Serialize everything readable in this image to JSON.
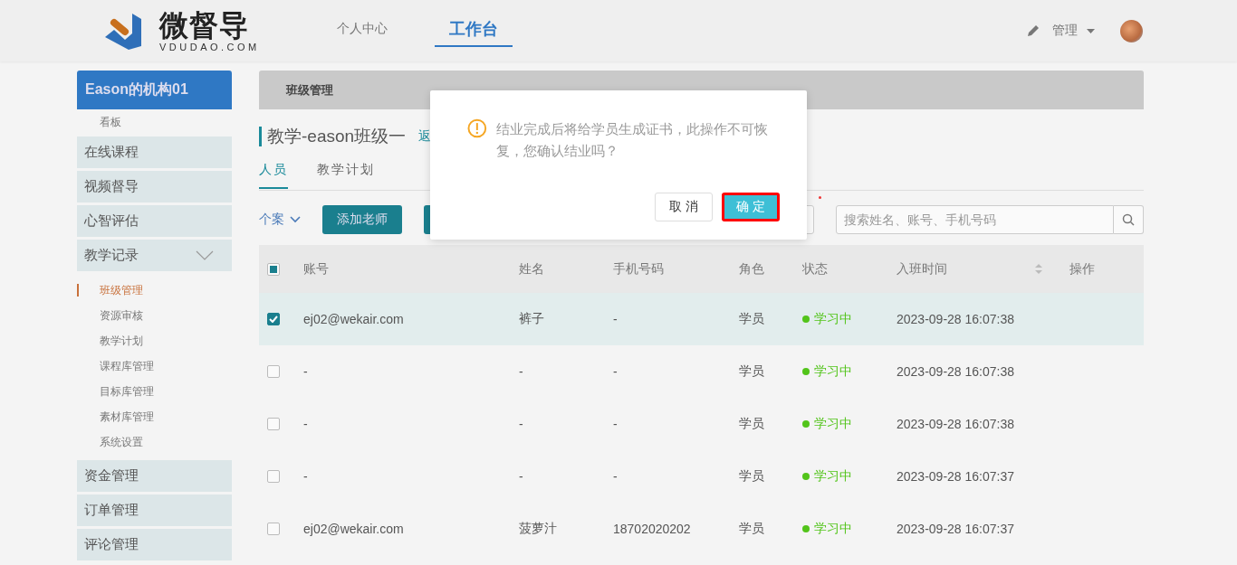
{
  "header": {
    "logo_text": "微督导",
    "logo_domain": "VDUDAO.COM",
    "nav": [
      {
        "label": "个人中心",
        "selected": false
      },
      {
        "label": "工作台",
        "selected": true
      }
    ],
    "user_menu": "管理"
  },
  "sidebar": {
    "org": "Eason的机构01",
    "items": [
      {
        "label": "看板",
        "kind": "sub",
        "selected": false
      },
      {
        "label": "在线课程",
        "kind": "group"
      },
      {
        "label": "视频督导",
        "kind": "group"
      },
      {
        "label": "心智评估",
        "kind": "group"
      },
      {
        "label": "教学记录",
        "kind": "group",
        "expanded": true,
        "children": [
          {
            "label": "班级管理",
            "selected": true
          },
          {
            "label": "资源审核",
            "selected": false
          },
          {
            "label": "教学计划",
            "selected": false
          },
          {
            "label": "课程库管理",
            "selected": false
          },
          {
            "label": "目标库管理",
            "selected": false
          },
          {
            "label": "素材库管理",
            "selected": false
          },
          {
            "label": "系统设置",
            "selected": false
          }
        ]
      },
      {
        "label": "资金管理",
        "kind": "group"
      },
      {
        "label": "订单管理",
        "kind": "group"
      },
      {
        "label": "评论管理",
        "kind": "group"
      }
    ]
  },
  "breadcrumb": "班级管理",
  "class_title": "教学-eason班级一",
  "back_link": "返",
  "tabs": [
    {
      "label": "人员",
      "selected": true
    },
    {
      "label": "教学计划",
      "selected": false
    }
  ],
  "toolbar": {
    "filter": "个案",
    "add_button": "添加老师",
    "search": {
      "placeholder": "搜索姓名、账号、手机号码"
    }
  },
  "table": {
    "header_checkbox": {
      "indeterminate": true
    },
    "columns": [
      "账号",
      "姓名",
      "手机号码",
      "角色",
      "状态",
      "入班时间",
      "操作"
    ],
    "rows": [
      {
        "checked": true,
        "account": "ej02@wekair.com",
        "name": "裤子",
        "phone": "-",
        "role": "学员",
        "status": "学习中",
        "color": "#52c41a",
        "joined": "2023-09-28 16:07:38"
      },
      {
        "checked": false,
        "account": "-",
        "name": "-",
        "phone": "-",
        "role": "学员",
        "status": "学习中",
        "color": "#52c41a",
        "joined": "2023-09-28 16:07:38"
      },
      {
        "checked": false,
        "account": "-",
        "name": "-",
        "phone": "-",
        "role": "学员",
        "status": "学习中",
        "color": "#52c41a",
        "joined": "2023-09-28 16:07:38"
      },
      {
        "checked": false,
        "account": "-",
        "name": "-",
        "phone": "-",
        "role": "学员",
        "status": "学习中",
        "color": "#52c41a",
        "joined": "2023-09-28 16:07:37"
      },
      {
        "checked": false,
        "account": "ej02@wekair.com",
        "name": "菠萝汁",
        "phone": "18702020202",
        "role": "学员",
        "status": "学习中",
        "color": "#52c41a",
        "joined": "2023-09-28 16:07:37"
      }
    ]
  },
  "dialog": {
    "message": "结业完成后将给学员生成证书，此操作不可恢复，您确认结业吗？",
    "buttons": [
      {
        "label": "取 消",
        "kind": "default"
      },
      {
        "label": "确 定",
        "kind": "primary"
      }
    ]
  }
}
